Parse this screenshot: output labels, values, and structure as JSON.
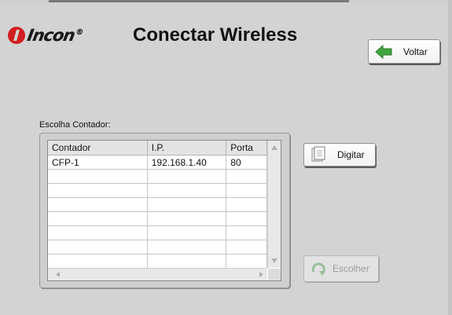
{
  "header": {
    "logo_text": "Incon",
    "logo_reg": "®",
    "title": "Conectar Wireless"
  },
  "buttons": {
    "voltar": "Voltar",
    "digitar": "Digitar",
    "escolher": "Escolher"
  },
  "section": {
    "label": "Escolha Contador:"
  },
  "table": {
    "columns": [
      "Contador",
      "I.P.",
      "Porta"
    ],
    "rows": [
      [
        "CFP-1",
        "192.168.1.40",
        "80"
      ]
    ]
  },
  "icons": {
    "voltar": "green-left-arrow-icon",
    "digitar": "document-icon",
    "escolher": "refresh-arrow-icon"
  },
  "colors": {
    "background": "#d3d3d3",
    "logo_red": "#d21e1e",
    "arrow_green": "#3fa53f"
  }
}
